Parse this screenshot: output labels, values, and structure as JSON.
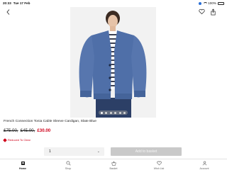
{
  "status_bar": {
    "time": "20:33",
    "date": "Tue 17 Feb",
    "battery": "100%"
  },
  "product": {
    "title": "French Connection Tonia Cable Sleeve Cardigan, Slate Blue",
    "prices": {
      "original": "£75.00,",
      "previous": "£45.00,",
      "current": "£30.00"
    },
    "promo": "Reduced To Clear",
    "image_count": 6,
    "active_image": 0
  },
  "purchase": {
    "quantity": "1",
    "add_to_basket": "Add to basket"
  },
  "tabs": [
    {
      "label": "Home",
      "icon": "home-icon",
      "active": true
    },
    {
      "label": "Shop",
      "icon": "search-icon",
      "active": false
    },
    {
      "label": "Basket",
      "icon": "basket-icon",
      "active": false
    },
    {
      "label": "Wish List",
      "icon": "heart-icon",
      "active": false
    },
    {
      "label": "Account",
      "icon": "account-icon",
      "active": false
    }
  ],
  "colors": {
    "sale_red": "#d0021b",
    "cardigan": "#4f6fa8",
    "disabled_button": "#c9c9c9"
  }
}
